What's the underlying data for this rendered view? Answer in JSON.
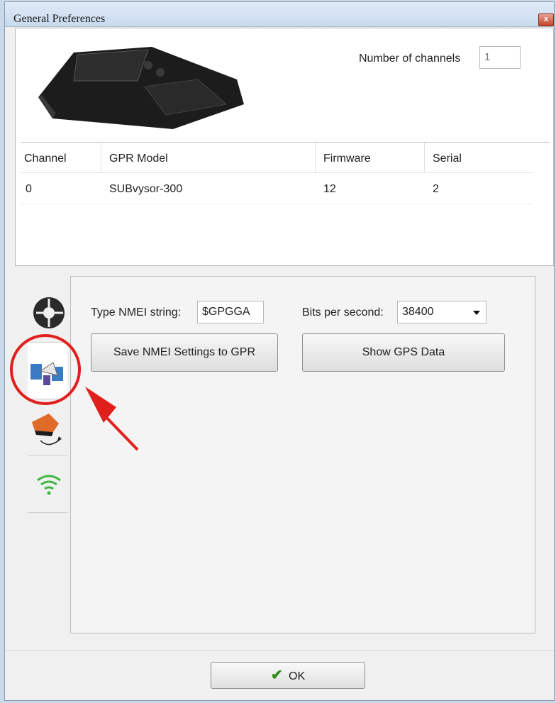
{
  "window": {
    "title": "General Preferences",
    "close_label": "x"
  },
  "channels": {
    "label": "Number of channels",
    "value": "1"
  },
  "table": {
    "columns": [
      "Channel",
      "GPR Model",
      "Firmware",
      "Serial"
    ],
    "rows": [
      {
        "channel": "0",
        "model": "SUBvysor-300",
        "firmware": "12",
        "serial": "2"
      }
    ]
  },
  "tabs": [
    {
      "icon": "wheel-icon",
      "active": false
    },
    {
      "icon": "gps-satellite-icon",
      "active": true
    },
    {
      "icon": "device-sync-icon",
      "active": false
    },
    {
      "icon": "wifi-icon",
      "active": false
    }
  ],
  "gps": {
    "nmea_label": "Type NMEI string:",
    "nmea_value": "$GPGGA",
    "bps_label": "Bits per second:",
    "bps_value": "38400",
    "save_button": "Save NMEI Settings to GPR",
    "show_button": "Show GPS Data"
  },
  "ok_button": "OK",
  "colors": {
    "annotation": "#e0201c",
    "wifi": "#3db83d",
    "accent": "#c2452e"
  }
}
